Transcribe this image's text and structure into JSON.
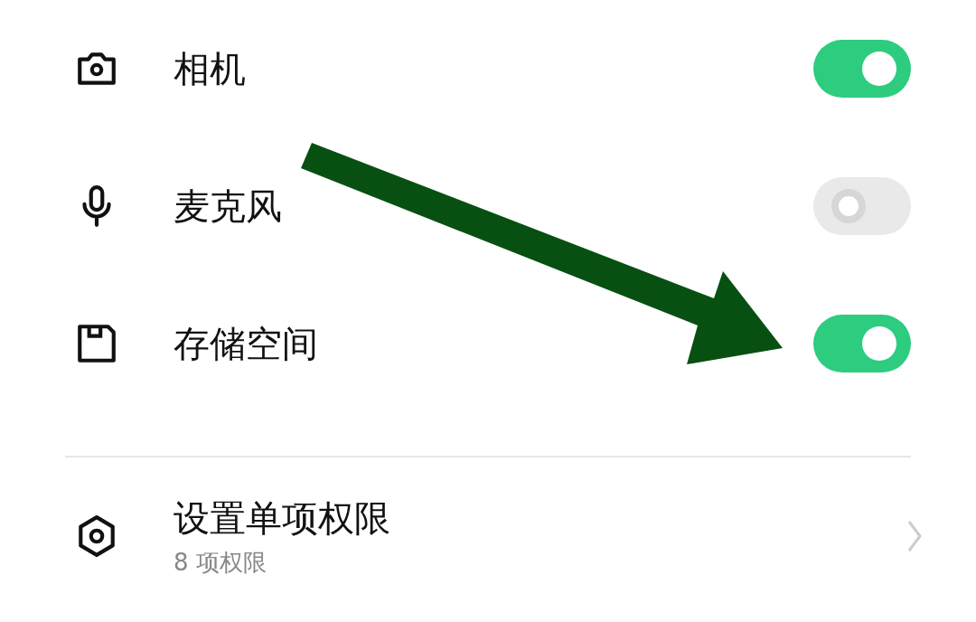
{
  "permissions": [
    {
      "kind": "camera",
      "label": "相机",
      "on": true
    },
    {
      "kind": "microphone",
      "label": "麦克风",
      "on": false
    },
    {
      "kind": "storage",
      "label": "存储空间",
      "on": true
    }
  ],
  "individual_permissions": {
    "title": "设置单项权限",
    "subtitle": "8 项权限"
  }
}
